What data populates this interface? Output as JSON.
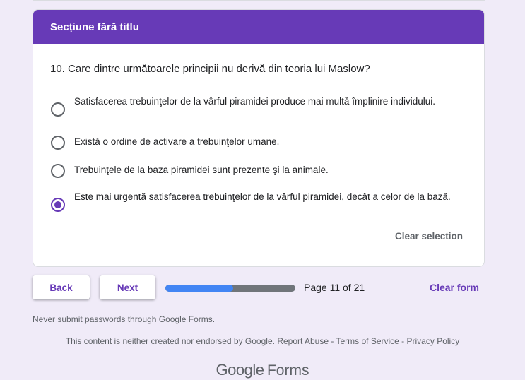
{
  "section": {
    "title": "Secțiune fără titlu"
  },
  "question": {
    "title": "10. Care dintre următoarele principii nu derivă din teoria lui Maslow?",
    "options": [
      {
        "label": "Satisfacerea trebuinţelor de la vârful piramidei produce mai multă împlinire individului.",
        "selected": false
      },
      {
        "label": "Există o ordine de activare a trebuinţelor umane.",
        "selected": false
      },
      {
        "label": "Trebuinţele de la baza piramidei sunt prezente şi la animale.",
        "selected": false
      },
      {
        "label": "Este mai urgentă satisfacerea trebuinţelor de la vârful piramidei, decât a celor de la bază.",
        "selected": true
      }
    ],
    "clear_selection": "Clear selection"
  },
  "navigation": {
    "back": "Back",
    "next": "Next",
    "progress_fraction": 0.52,
    "page_label": "Page 11 of 21",
    "clear_form": "Clear form"
  },
  "footer": {
    "warning": "Never submit passwords through Google Forms.",
    "disclaimer": "This content is neither created nor endorsed by Google.",
    "report_abuse": "Report Abuse",
    "separator": " - ",
    "terms": "Terms of Service",
    "privacy": "Privacy Policy",
    "logo_google": "Google",
    "logo_forms": "Forms"
  },
  "colors": {
    "accent": "#673ab7",
    "background": "#f0ebf8",
    "progress": "#4285f4"
  }
}
